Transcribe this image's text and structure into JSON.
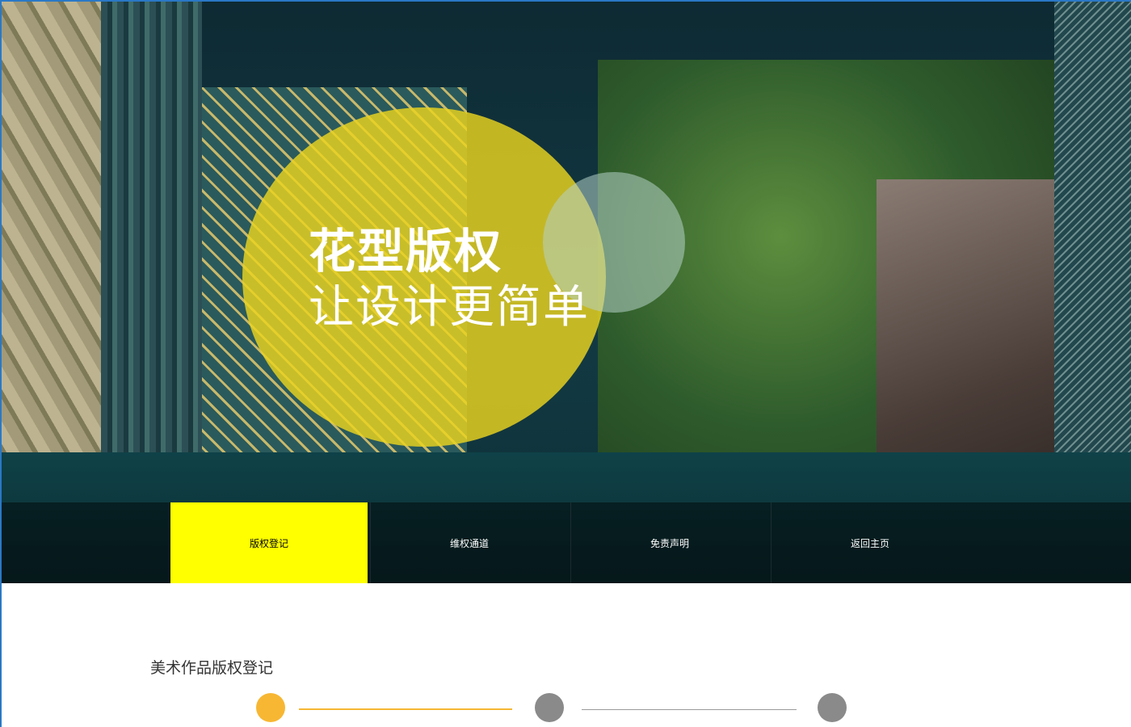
{
  "hero": {
    "title": "花型版权",
    "subtitle": "让设计更简单"
  },
  "nav": {
    "items": [
      {
        "label": "版权登记",
        "active": true
      },
      {
        "label": "维权通道",
        "active": false
      },
      {
        "label": "免责声明",
        "active": false
      },
      {
        "label": "返回主页",
        "active": false
      }
    ]
  },
  "section": {
    "title": "美术作品版权登记"
  },
  "steps": {
    "current": 1,
    "total": 3
  },
  "colors": {
    "nav_active": "#ffff00",
    "step_active": "#f7b733",
    "step_inactive": "#8a8a8a"
  }
}
